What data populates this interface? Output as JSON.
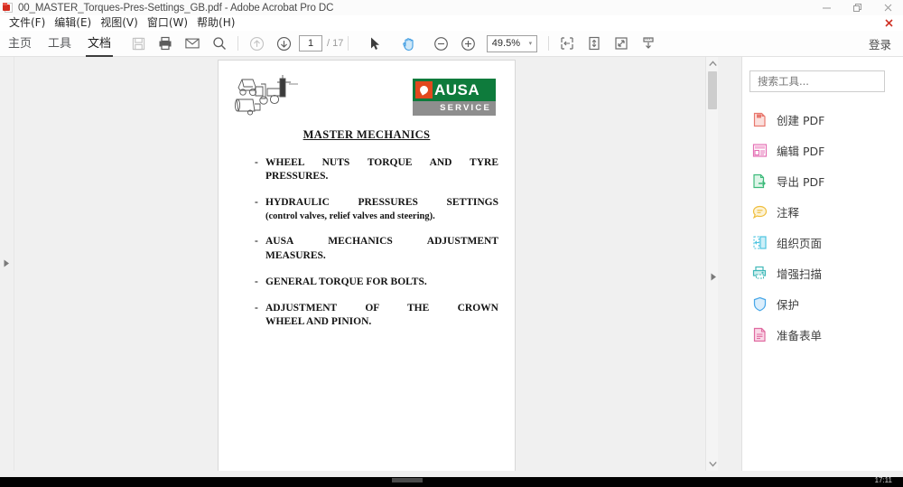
{
  "window": {
    "title": "00_MASTER_Torques-Pres-Settings_GB.pdf - Adobe Acrobat Pro DC",
    "app_icon": "acrobat-icon",
    "minimize": "–",
    "restore": "❐",
    "close": "✕",
    "close_document": "✖"
  },
  "menu": {
    "items": [
      {
        "label": "文件(F)"
      },
      {
        "label": "编辑(E)"
      },
      {
        "label": "视图(V)"
      },
      {
        "label": "窗口(W)"
      },
      {
        "label": "帮助(H)"
      }
    ]
  },
  "toolbar": {
    "tabs": [
      {
        "label": "主页",
        "active": false
      },
      {
        "label": "工具",
        "active": false
      },
      {
        "label": "文档",
        "active": true
      }
    ],
    "icons_left": [
      "save-icon",
      "print-icon",
      "email-icon",
      "search-icon"
    ],
    "nav": {
      "prev_page_icon": "arrow-up-circle-icon",
      "next_page_icon": "arrow-down-circle-icon",
      "page_value": "1",
      "page_total": "/ 17"
    },
    "tools": {
      "select_icon": "cursor-arrow-icon",
      "hand_icon": "hand-tool-icon",
      "zoom_out_icon": "minus-circle-icon",
      "zoom_in_icon": "plus-circle-icon"
    },
    "zoom": {
      "value": "49.5%",
      "caret": "▾"
    },
    "view_icons": [
      "page-fit-width-icon",
      "page-scroll-icon",
      "page-fullscreen-icon",
      "page-download-icon"
    ],
    "sign_in": "登录"
  },
  "document": {
    "logo_art": "machinery-line-drawing",
    "brand": {
      "mark": "ausa-flame-mark",
      "name": "AUSA",
      "subtitle": "SERVICE",
      "green": "#0e7b3c",
      "orange": "#e2481e",
      "gray": "#8e8e8e"
    },
    "title": "MASTER MECHANICS",
    "items": [
      {
        "dash": "-",
        "line1": "WHEEL NUTS TORQUE AND TYRE",
        "line2": "PRESSURES.",
        "justify": true
      },
      {
        "dash": "-",
        "line1": "HYDRAULIC PRESSURES SETTINGS",
        "line2": "(control valves, relief valves and steering).",
        "justify": true,
        "sub": true
      },
      {
        "dash": "-",
        "line1": "AUSA MECHANICS ADJUSTMENT",
        "line2": "MEASURES.",
        "justify": true
      },
      {
        "dash": "-",
        "line1": "GENERAL TORQUE FOR BOLTS.",
        "line2": "",
        "justify": false
      },
      {
        "dash": "-",
        "line1": "ADJUSTMENT OF THE CROWN",
        "line2": "WHEEL AND PINION.",
        "justify": true
      }
    ]
  },
  "navpane": {
    "expand_icon": "triangle-right-icon"
  },
  "scrollbar": {
    "up_arrow": "∧",
    "down_arrow": "∨",
    "collapse_icon": "triangle-right-icon"
  },
  "rightpane": {
    "search": {
      "placeholder": "搜索工具...",
      "value": ""
    },
    "tools": [
      {
        "label": "创建 PDF",
        "icon": "create-pdf-icon",
        "color": "#e8786e"
      },
      {
        "label": "编辑 PDF",
        "icon": "edit-pdf-icon",
        "color": "#e46fb4"
      },
      {
        "label": "导出 PDF",
        "icon": "export-pdf-icon",
        "color": "#3cba7a"
      },
      {
        "label": "注释",
        "icon": "comment-icon",
        "color": "#efbe3d"
      },
      {
        "label": "组织页面",
        "icon": "organize-pages-icon",
        "color": "#4ec4e0"
      },
      {
        "label": "增强扫描",
        "icon": "enhance-scan-icon",
        "color": "#3fb8b8"
      },
      {
        "label": "保护",
        "icon": "shield-icon",
        "color": "#4aa8e8"
      },
      {
        "label": "准备表单",
        "icon": "prepare-form-icon",
        "color": "#e06aa0"
      }
    ]
  },
  "taskbar": {
    "clock": "17:11"
  }
}
